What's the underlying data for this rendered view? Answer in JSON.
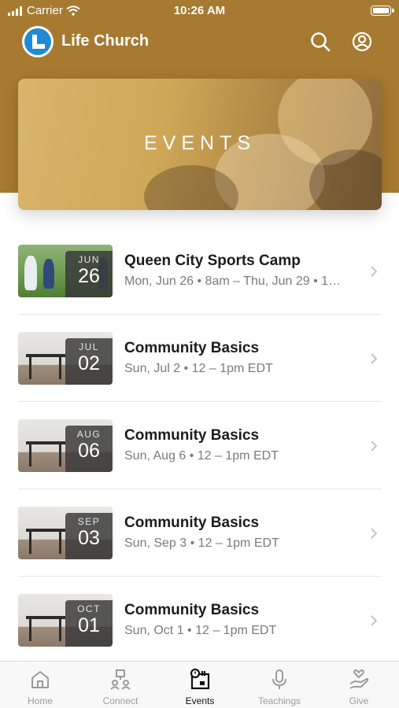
{
  "status_bar": {
    "carrier": "Carrier",
    "time": "10:26 AM"
  },
  "app": {
    "name": "Life Church"
  },
  "banner": {
    "title": "EVENTS"
  },
  "events": [
    {
      "title": "Queen City Sports Camp",
      "subtitle": "Mon, Jun 26 • 8am – Thu, Jun 29 • 1…",
      "month": "JUN",
      "day": "26",
      "image": "sports-camp"
    },
    {
      "title": "Community Basics",
      "subtitle": "Sun, Jul 2 • 12 – 1pm EDT",
      "month": "JUL",
      "day": "02",
      "image": "table"
    },
    {
      "title": "Community Basics",
      "subtitle": "Sun, Aug 6 • 12 – 1pm EDT",
      "month": "AUG",
      "day": "06",
      "image": "table"
    },
    {
      "title": "Community Basics",
      "subtitle": "Sun, Sep 3 • 12 – 1pm EDT",
      "month": "SEP",
      "day": "03",
      "image": "table"
    },
    {
      "title": "Community Basics",
      "subtitle": "Sun, Oct 1 • 12 – 1pm EDT",
      "month": "OCT",
      "day": "01",
      "image": "table"
    }
  ],
  "tabs": [
    {
      "label": "Home",
      "icon": "home-icon",
      "active": false
    },
    {
      "label": "Connect",
      "icon": "connect-icon",
      "active": false
    },
    {
      "label": "Events",
      "icon": "events-icon",
      "active": true
    },
    {
      "label": "Teachings",
      "icon": "microphone-icon",
      "active": false
    },
    {
      "label": "Give",
      "icon": "give-icon",
      "active": false
    }
  ],
  "colors": {
    "header": "#a67a30",
    "brand_blue": "#1f8bd6",
    "active_tab": "#111111",
    "inactive_tab": "#9a9a9a"
  }
}
